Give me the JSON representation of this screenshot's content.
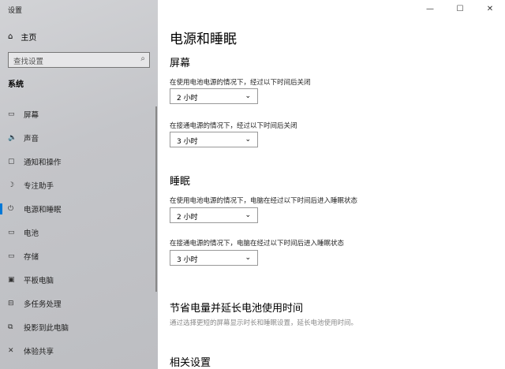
{
  "app": {
    "title": "设置"
  },
  "sidebar": {
    "home": "主页",
    "search_placeholder": "查找设置",
    "section": "系统",
    "items": [
      {
        "label": "屏幕",
        "icon": "▭"
      },
      {
        "label": "声音",
        "icon": "🔈"
      },
      {
        "label": "通知和操作",
        "icon": "▢"
      },
      {
        "label": "专注助手",
        "icon": "☽"
      },
      {
        "label": "电源和睡眠",
        "icon": "⏻"
      },
      {
        "label": "电池",
        "icon": "▭"
      },
      {
        "label": "存储",
        "icon": "▭"
      },
      {
        "label": "平板电脑",
        "icon": "▣"
      },
      {
        "label": "多任务处理",
        "icon": "⊟"
      },
      {
        "label": "投影到此电脑",
        "icon": "⧉"
      },
      {
        "label": "体验共享",
        "icon": "✕"
      }
    ]
  },
  "main": {
    "title": "电源和睡眠",
    "screen": {
      "heading": "屏幕",
      "battery_label": "在使用电池电源的情况下，经过以下时间后关闭",
      "battery_value": "2 小时",
      "plugged_label": "在接通电源的情况下，经过以下时间后关闭",
      "plugged_value": "3 小时"
    },
    "sleep": {
      "heading": "睡眠",
      "battery_label": "在使用电池电源的情况下，电脑在经过以下时间后进入睡眠状态",
      "battery_value": "2 小时",
      "plugged_label": "在接通电源的情况下，电脑在经过以下时间后进入睡眠状态",
      "plugged_value": "3 小时"
    },
    "save": {
      "heading": "节省电量并延长电池使用时间",
      "desc": "通过选择更短的屏幕显示时长和睡眠设置，延长电池使用时间。"
    },
    "related": {
      "heading": "相关设置"
    }
  }
}
